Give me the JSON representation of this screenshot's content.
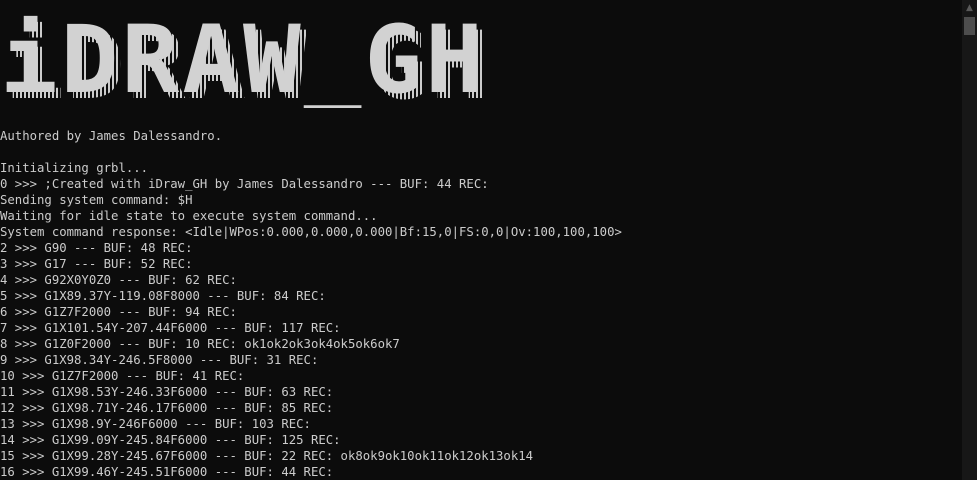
{
  "banner": {
    "title": "iDRAW_GH"
  },
  "output_lines": [
    "Authored by James Dalessandro.",
    "",
    "Initializing grbl...",
    "0 >>> ;Created with iDraw_GH by James Dalessandro --- BUF: 44 REC:",
    "Sending system command: $H",
    "Waiting for idle state to execute system command...",
    "System command response: <Idle|WPos:0.000,0.000,0.000|Bf:15,0|FS:0,0|Ov:100,100,100>",
    "2 >>> G90 --- BUF: 48 REC:",
    "3 >>> G17 --- BUF: 52 REC:",
    "4 >>> G92X0Y0Z0 --- BUF: 62 REC:",
    "5 >>> G1X89.37Y-119.08F8000 --- BUF: 84 REC:",
    "6 >>> G1Z7F2000 --- BUF: 94 REC:",
    "7 >>> G1X101.54Y-207.44F6000 --- BUF: 117 REC:",
    "8 >>> G1Z0F2000 --- BUF: 10 REC: ok1ok2ok3ok4ok5ok6ok7",
    "9 >>> G1X98.34Y-246.5F8000 --- BUF: 31 REC:",
    "10 >>> G1Z7F2000 --- BUF: 41 REC:",
    "11 >>> G1X98.53Y-246.33F6000 --- BUF: 63 REC:",
    "12 >>> G1X98.71Y-246.17F6000 --- BUF: 85 REC:",
    "13 >>> G1X98.9Y-246F6000 --- BUF: 103 REC:",
    "14 >>> G1X99.09Y-245.84F6000 --- BUF: 125 REC:",
    "15 >>> G1X99.28Y-245.67F6000 --- BUF: 22 REC: ok8ok9ok10ok11ok12ok13ok14",
    "16 >>> G1X99.46Y-245.51F6000 --- BUF: 44 REC:"
  ],
  "scrollbar": {
    "up_arrow": "▲"
  },
  "colors": {
    "background": "#0c0c0c",
    "foreground": "#cccccc",
    "banner_fill": "#cccccc",
    "banner_outline": "#cccccc"
  }
}
